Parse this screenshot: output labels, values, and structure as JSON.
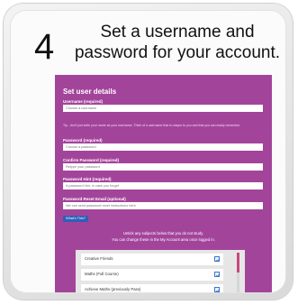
{
  "step": {
    "number": "4",
    "heading": "Set a username and password for your account."
  },
  "form": {
    "title": "Set user details",
    "username_label": "Username (required)",
    "username_placeholder": "Choose a username",
    "tip": "Tip - don't just write your name as your username. Think of a username that is unique to you and that you can easily remember.",
    "password_label": "Password (required)",
    "password_placeholder": "Choose a password",
    "confirm_label": "Confirm Password (required)",
    "confirm_placeholder": "Retype your password",
    "hint_label": "Password Hint (required)",
    "hint_placeholder": "A password hint, in case you forget",
    "reset_label": "Password Reset Email (optional)",
    "reset_placeholder": "We can send password reset instructions here",
    "whats_this": "What's This?",
    "note_line1": "Untick any subjects below that you do not study.",
    "note_line2": "You can change these in the My Account area once logged in."
  },
  "subjects": [
    {
      "label": "Creative Friends",
      "checked": true
    },
    {
      "label": "Maths (Full Course)",
      "checked": true
    },
    {
      "label": "Achieve Maths (previously Pass)",
      "checked": true
    }
  ],
  "colors": {
    "form_background": "#a3449b",
    "button": "#2f5fb7",
    "scroll_thumb": "#c64a7d"
  }
}
